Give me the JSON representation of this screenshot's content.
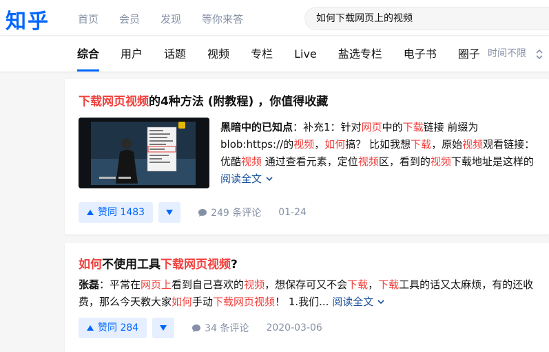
{
  "header": {
    "logo": "知乎",
    "nav": [
      "首页",
      "会员",
      "发现",
      "等你来答"
    ],
    "search_value": "如何下载网页上的视频"
  },
  "tabs": {
    "items": [
      "综合",
      "用户",
      "话题",
      "视频",
      "专栏",
      "Live",
      "盐选专栏",
      "电子书",
      "圈子"
    ],
    "active": "综合",
    "time_filter": "时间不限"
  },
  "results": [
    {
      "title_parts": [
        {
          "text": "下载网页视频",
          "hl": true
        },
        {
          "text": "的4种方法 (附教程) ，你值得收藏",
          "hl": false
        }
      ],
      "author": "黑暗中的已知点",
      "excerpt_parts": [
        {
          "text": "：补充1：针对",
          "hl": false
        },
        {
          "text": "网页",
          "hl": true
        },
        {
          "text": "中的",
          "hl": false
        },
        {
          "text": "下载",
          "hl": true
        },
        {
          "text": "链接 前缀为blob:https://的",
          "hl": false
        },
        {
          "text": "视频",
          "hl": true
        },
        {
          "text": "，",
          "hl": false
        },
        {
          "text": "如何",
          "hl": true
        },
        {
          "text": "搞？ 比如我想",
          "hl": false
        },
        {
          "text": "下载",
          "hl": true
        },
        {
          "text": "，原始",
          "hl": false
        },
        {
          "text": "视频",
          "hl": true
        },
        {
          "text": "观看链接：优酷",
          "hl": false
        },
        {
          "text": "视频",
          "hl": true
        },
        {
          "text": " 通过查看元素，定位",
          "hl": false
        },
        {
          "text": "视频",
          "hl": true
        },
        {
          "text": "区，看到的",
          "hl": false
        },
        {
          "text": "视频",
          "hl": true
        },
        {
          "text": "下载地址是这样的 ",
          "hl": false
        }
      ],
      "read_more": "阅读全文",
      "vote_label": "赞同 1483",
      "comments": "249 条评论",
      "date": "01-24"
    },
    {
      "title_parts": [
        {
          "text": "如何",
          "hl": true
        },
        {
          "text": "不使用工具",
          "hl": false
        },
        {
          "text": "下载网页视频",
          "hl": true
        },
        {
          "text": "?",
          "hl": false
        }
      ],
      "author": "张磊",
      "excerpt_parts": [
        {
          "text": "：平常在",
          "hl": false
        },
        {
          "text": "网页上",
          "hl": true
        },
        {
          "text": "看到自己喜欢的",
          "hl": false
        },
        {
          "text": "视频",
          "hl": true
        },
        {
          "text": "，想保存可又不会",
          "hl": false
        },
        {
          "text": "下载",
          "hl": true
        },
        {
          "text": "，",
          "hl": false
        },
        {
          "text": "下载",
          "hl": true
        },
        {
          "text": "工具的话又太麻烦，有的还收费，那么今天教大家",
          "hl": false
        },
        {
          "text": "如何",
          "hl": true
        },
        {
          "text": "手动",
          "hl": false
        },
        {
          "text": "下载网页视频",
          "hl": true
        },
        {
          "text": "！ 1.我们... ",
          "hl": false
        }
      ],
      "read_more": "阅读全文",
      "vote_label": "赞同 284",
      "comments": "34 条评论",
      "date": "2020-03-06"
    }
  ],
  "colors": {
    "brand": "#0066ff",
    "highlight": "#f1403c",
    "link": "#175199",
    "meta": "#8590a6"
  }
}
